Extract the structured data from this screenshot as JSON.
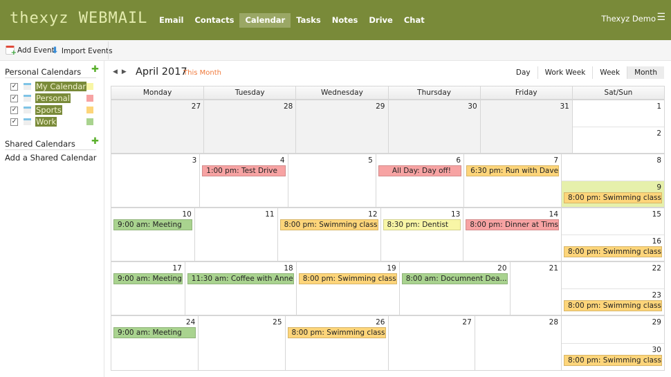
{
  "app": {
    "logo": "thexyz WEBMAIL",
    "user": "Thexyz Demo"
  },
  "nav": [
    {
      "label": "Email"
    },
    {
      "label": "Contacts"
    },
    {
      "label": "Calendar",
      "active": true
    },
    {
      "label": "Tasks"
    },
    {
      "label": "Notes"
    },
    {
      "label": "Drive"
    },
    {
      "label": "Chat"
    }
  ],
  "toolbar": {
    "add_event": "Add Event",
    "import_events": "Import Events"
  },
  "sidebar": {
    "personal_title": "Personal Calendars",
    "calendars": [
      {
        "label": "My Calendar",
        "color": "#f8f6a6"
      },
      {
        "label": "Personal",
        "color": "#f7a3a3"
      },
      {
        "label": "Sports",
        "color": "#fdd57a"
      },
      {
        "label": "Work",
        "color": "#a9d38f"
      }
    ],
    "shared_title": "Shared Calendars",
    "add_shared": "Add a Shared Calendar"
  },
  "header": {
    "title": "April 2017",
    "this_month": "This Month",
    "views": [
      {
        "label": "Day"
      },
      {
        "label": "Work Week"
      },
      {
        "label": "Week"
      },
      {
        "label": "Month",
        "active": true
      }
    ]
  },
  "columns": [
    "Monday",
    "Tuesday",
    "Wednesday",
    "Thursday",
    "Friday",
    "Sat/Sun"
  ],
  "colors": {
    "My Calendar": "#f8f6a6",
    "Personal": "#f7a3a3",
    "Sports": "#fdd57a",
    "Work": "#a9d38f",
    "today": "#e6f0ab"
  },
  "weeks": [
    {
      "days": [
        {
          "d": "27",
          "other": true
        },
        {
          "d": "28",
          "other": true
        },
        {
          "d": "29",
          "other": true
        },
        {
          "d": "30",
          "other": true
        },
        {
          "d": "31",
          "other": true
        },
        {
          "d": "1"
        },
        {
          "d": "2"
        }
      ]
    },
    {
      "days": [
        {
          "d": "3"
        },
        {
          "d": "4",
          "events": [
            {
              "text": "1:00 pm: Test Drive",
              "cal": "Personal"
            }
          ]
        },
        {
          "d": "5"
        },
        {
          "d": "6",
          "events": [
            {
              "text": "All Day: Day off!",
              "cal": "Personal",
              "center": true
            }
          ]
        },
        {
          "d": "7",
          "events": [
            {
              "text": "6:30 pm: Run with Dave",
              "cal": "Sports"
            }
          ]
        },
        {
          "d": "8"
        },
        {
          "d": "9",
          "today": true,
          "events": [
            {
              "text": "8:00 pm: Swimming class",
              "cal": "Sports"
            }
          ]
        }
      ]
    },
    {
      "days": [
        {
          "d": "10",
          "events": [
            {
              "text": "9:00 am: Meeting",
              "cal": "Work"
            }
          ]
        },
        {
          "d": "11"
        },
        {
          "d": "12",
          "events": [
            {
              "text": "8:00 pm: Swimming class",
              "cal": "Sports"
            }
          ]
        },
        {
          "d": "13",
          "events": [
            {
              "text": "8:30 pm: Dentist",
              "cal": "My Calendar"
            }
          ]
        },
        {
          "d": "14",
          "events": [
            {
              "text": "8:00 pm: Dinner at Tims",
              "cal": "Personal"
            }
          ]
        },
        {
          "d": "15"
        },
        {
          "d": "16",
          "events": [
            {
              "text": "8:00 pm: Swimming class",
              "cal": "Sports"
            }
          ]
        }
      ]
    },
    {
      "days": [
        {
          "d": "17",
          "events": [
            {
              "text": "9:00 am: Meeting",
              "cal": "Work"
            }
          ]
        },
        {
          "d": "18",
          "events": [
            {
              "text": "11:30 am: Coffee with Anne",
              "cal": "Work"
            }
          ]
        },
        {
          "d": "19",
          "events": [
            {
              "text": "8:00 pm: Swimming class",
              "cal": "Sports"
            }
          ]
        },
        {
          "d": "20",
          "events": [
            {
              "text": "8:00 am: Documnent Dea...",
              "cal": "Work"
            }
          ]
        },
        {
          "d": "21"
        },
        {
          "d": "22"
        },
        {
          "d": "23",
          "events": [
            {
              "text": "8:00 pm: Swimming class",
              "cal": "Sports"
            }
          ]
        }
      ]
    },
    {
      "days": [
        {
          "d": "24",
          "events": [
            {
              "text": "9:00 am: Meeting",
              "cal": "Work"
            }
          ]
        },
        {
          "d": "25"
        },
        {
          "d": "26",
          "events": [
            {
              "text": "8:00 pm: Swimming class",
              "cal": "Sports"
            }
          ]
        },
        {
          "d": "27"
        },
        {
          "d": "28"
        },
        {
          "d": "29"
        },
        {
          "d": "30",
          "events": [
            {
              "text": "8:00 pm: Swimming class",
              "cal": "Sports"
            }
          ]
        }
      ]
    }
  ]
}
